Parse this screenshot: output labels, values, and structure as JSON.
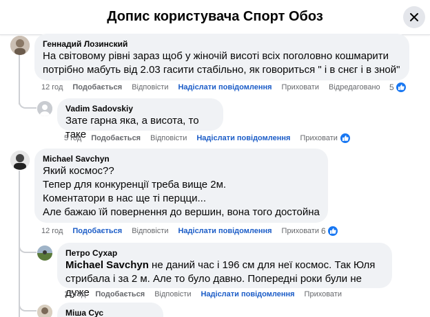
{
  "header": {
    "title": "Допис користувача Спорт Обоз"
  },
  "actions_labels": {
    "like": "Подобається",
    "reply": "Відповісти",
    "send": "Надіслати повідомлення",
    "hide": "Приховати",
    "edited": "Відредаговано"
  },
  "comments": [
    {
      "author": "Геннадий Лозинский",
      "lines": [
        "На світовому рівні зараз щоб у жіночій висоті всіх поголовно кошмарити",
        "потрібно мабуть від 2.03 гасити стабільно, як говориться \" і в снєг і в зной\""
      ],
      "time": "12 год",
      "reactions": "5"
    },
    {
      "author": "Vadim Sadovskiy",
      "lines": [
        "Зате гарна яка, а висота, то таке"
      ],
      "time": "5 год"
    },
    {
      "author": "Michael Savchyn",
      "lines": [
        "Який космос??",
        "Тепер для конкуренції треба вище 2м.",
        "Коментатори в нас ще ті перцци...",
        "Але бажаю їй повернення до вершин, вона того достойна"
      ],
      "time": "12 год",
      "reactions": "6"
    },
    {
      "author": "Петро Сухар",
      "mention": "Michael Savchyn",
      "lines": [
        " не даний час і 196 см для неї космос. Так Юля",
        "стрибала і за 2 м. Але то було давно. Попередні роки були не дуже"
      ],
      "time": "12 год"
    },
    {
      "author": "Міша Сус"
    }
  ]
}
